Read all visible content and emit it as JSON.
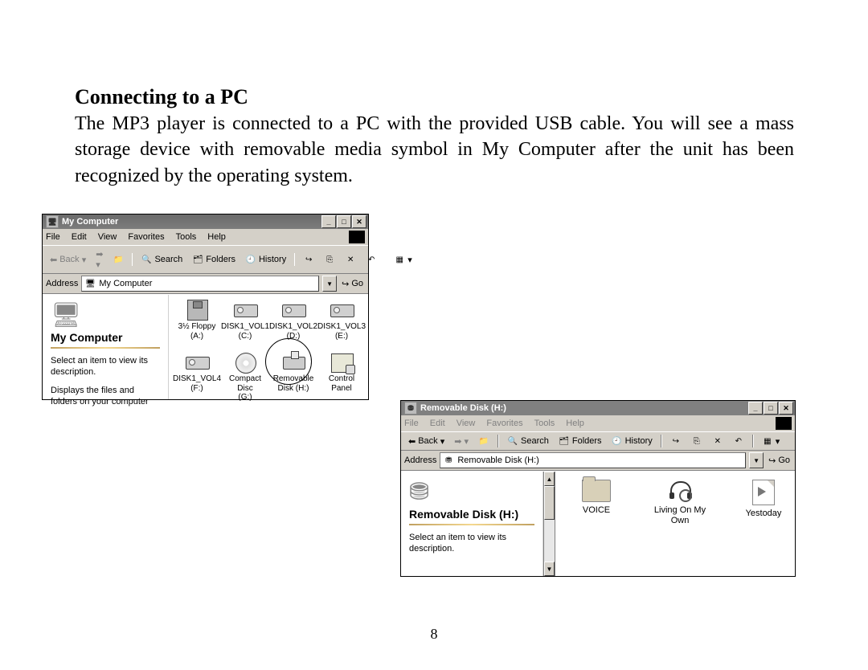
{
  "doc": {
    "heading": "Connecting to a PC",
    "body": "The MP3 player is connected to a PC with the provided USB cable. You will see a mass storage device with removable media symbol in My Computer after the unit has been recognized by the operating system.",
    "page_number": "8"
  },
  "win1": {
    "title": "My Computer",
    "menus": [
      "File",
      "Edit",
      "View",
      "Favorites",
      "Tools",
      "Help"
    ],
    "toolbar": {
      "back": "Back",
      "search": "Search",
      "folders": "Folders",
      "history": "History"
    },
    "address_label": "Address",
    "address_value": "My Computer",
    "go_label": "Go",
    "leftpane": {
      "title": "My Computer",
      "line1": "Select an item to view its description.",
      "line2": "Displays the files and folders on your computer"
    },
    "drives": [
      {
        "label1": "3½ Floppy",
        "label2": "(A:)",
        "kind": "floppy"
      },
      {
        "label1": "DISK1_VOL1",
        "label2": "(C:)",
        "kind": "hdd"
      },
      {
        "label1": "DISK1_VOL2",
        "label2": "(D:)",
        "kind": "hdd"
      },
      {
        "label1": "DISK1_VOL3",
        "label2": "(E:)",
        "kind": "hdd"
      },
      {
        "label1": "DISK1_VOL4",
        "label2": "(F:)",
        "kind": "hdd"
      },
      {
        "label1": "Compact Disc",
        "label2": "(G:)",
        "kind": "cd"
      },
      {
        "label1": "Removable",
        "label2": "Disk (H:)",
        "kind": "removable"
      },
      {
        "label1": "Control Panel",
        "label2": "",
        "kind": "cpanel"
      }
    ]
  },
  "win2": {
    "title": "Removable Disk (H:)",
    "menus": [
      "File",
      "Edit",
      "View",
      "Favorites",
      "Tools",
      "Help"
    ],
    "toolbar": {
      "back": "Back",
      "search": "Search",
      "folders": "Folders",
      "history": "History"
    },
    "address_label": "Address",
    "address_value": "Removable Disk (H:)",
    "go_label": "Go",
    "leftpane": {
      "title": "Removable Disk (H:)",
      "line1": "Select an item to view its description."
    },
    "files": [
      {
        "name": "VOICE",
        "kind": "folder"
      },
      {
        "name": "Living On My Own",
        "kind": "music"
      },
      {
        "name": "Yestoday",
        "kind": "audio"
      }
    ]
  }
}
